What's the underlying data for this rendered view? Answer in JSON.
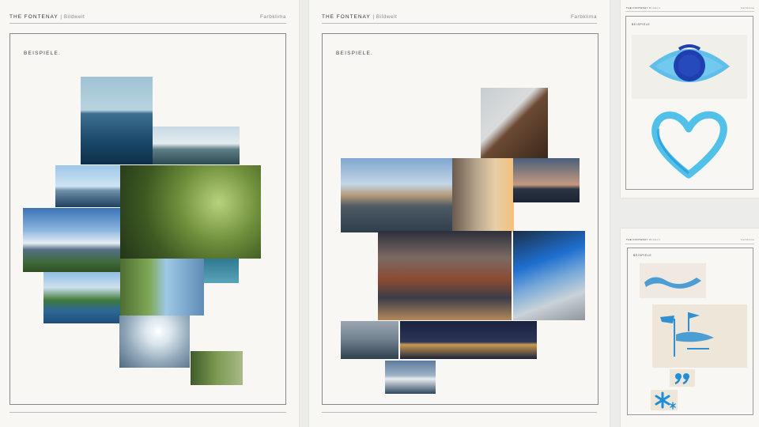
{
  "brand": "THE FONTENAY",
  "subtitle": "Bildwelt",
  "section": "Farbklima",
  "example_label": "BEISPIELE.",
  "small_label": "BEISPIELE",
  "icons": {
    "eye": "eye-watercolor-icon",
    "heart": "heart-watercolor-icon",
    "wave": "wave-brushstroke-icon",
    "flags": "flags-brushstroke-icon",
    "quote": "quote-mark-icon",
    "asterisk": "asterisk-icon"
  },
  "colors": {
    "paper": "#f8f7f4",
    "accent_blue": "#1e8fd6",
    "deep_blue": "#1a3ea8"
  }
}
